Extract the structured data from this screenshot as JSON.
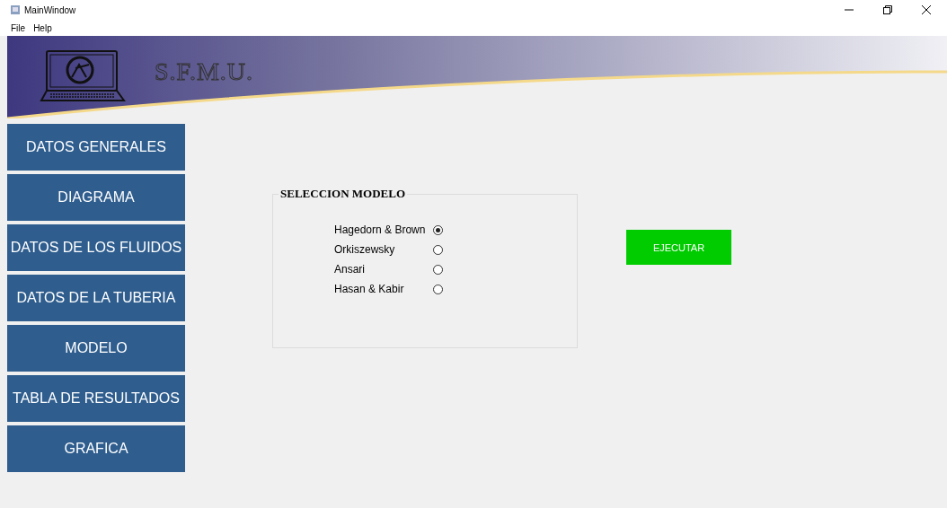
{
  "window": {
    "title": "MainWindow"
  },
  "menu": [
    "File",
    "Help"
  ],
  "banner": {
    "title": "S.F.M.U."
  },
  "sidebar": {
    "items": [
      {
        "label": "DATOS GENERALES"
      },
      {
        "label": "DIAGRAMA"
      },
      {
        "label": "DATOS DE LOS FLUIDOS"
      },
      {
        "label": "DATOS DE LA TUBERIA"
      },
      {
        "label": "MODELO"
      },
      {
        "label": "TABLA DE RESULTADOS"
      },
      {
        "label": "GRAFICA"
      }
    ]
  },
  "model_group": {
    "title": "SELECCION MODELO",
    "options": [
      {
        "label": "Hagedorn & Brown",
        "selected": true
      },
      {
        "label": "Orkiszewsky",
        "selected": false
      },
      {
        "label": "Ansari",
        "selected": false
      },
      {
        "label": "Hasan & Kabir",
        "selected": false
      }
    ]
  },
  "run_button": {
    "label": "EJECUTAR"
  }
}
